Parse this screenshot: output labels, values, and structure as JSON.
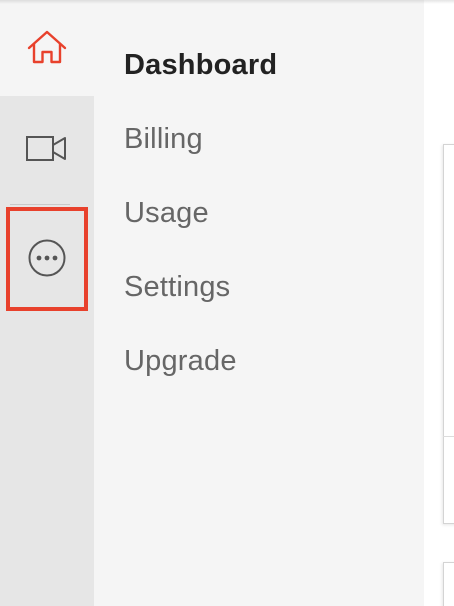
{
  "rail": {
    "items": [
      {
        "icon": "home-icon",
        "active": true
      },
      {
        "icon": "video-camera-icon",
        "active": false
      },
      {
        "icon": "more-options-icon",
        "active": false
      }
    ]
  },
  "menu": {
    "items": [
      {
        "label": "Dashboard",
        "active": true
      },
      {
        "label": "Billing",
        "active": false
      },
      {
        "label": "Usage",
        "active": false
      },
      {
        "label": "Settings",
        "active": false
      },
      {
        "label": "Upgrade",
        "active": false
      }
    ]
  },
  "colors": {
    "accent": "#e8412c",
    "home_icon": "#e8412c",
    "rail_bg": "#e6e6e6",
    "menu_bg": "#f5f5f5",
    "active_text": "#222222",
    "inactive_text": "#666666"
  }
}
